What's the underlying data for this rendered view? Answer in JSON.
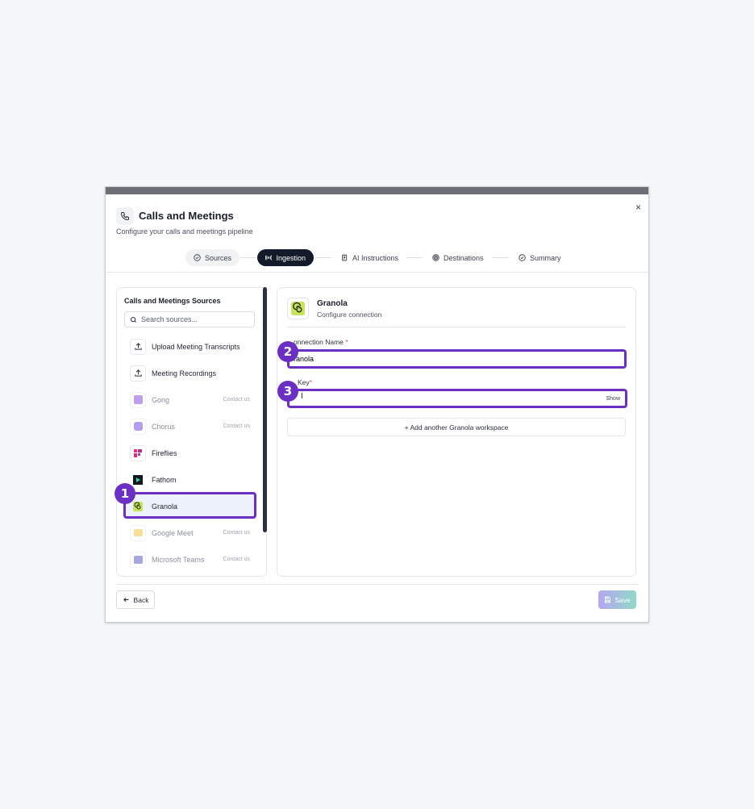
{
  "dialog": {
    "title": "Calls and Meetings",
    "subtitle": "Configure your calls and meetings pipeline",
    "close_label": "×"
  },
  "steps": [
    {
      "label": "Sources",
      "state": "done",
      "icon": "check-circle-icon"
    },
    {
      "label": "Ingestion",
      "state": "active",
      "icon": "broadcast-icon"
    },
    {
      "label": "AI Instructions",
      "state": "pending",
      "icon": "document-ai-icon"
    },
    {
      "label": "Destinations",
      "state": "pending",
      "icon": "target-icon"
    },
    {
      "label": "Summary",
      "state": "pending",
      "icon": "check-circle-icon"
    }
  ],
  "sources_panel": {
    "title": "Calls and Meetings Sources",
    "search_placeholder": "Search sources...",
    "items": [
      {
        "label": "Upload Meeting Transcripts",
        "icon": "upload-icon",
        "disabled": false
      },
      {
        "label": "Meeting Recordings",
        "icon": "upload-icon",
        "disabled": false
      },
      {
        "label": "Gong",
        "icon": "gong-logo-icon",
        "disabled": true,
        "note": "Contact us"
      },
      {
        "label": "Chorus",
        "icon": "chorus-logo-icon",
        "disabled": true,
        "note": "Contact us"
      },
      {
        "label": "Fireflies",
        "icon": "fireflies-logo-icon",
        "disabled": false
      },
      {
        "label": "Fathom",
        "icon": "fathom-logo-icon",
        "disabled": false
      },
      {
        "label": "Granola",
        "icon": "granola-logo-icon",
        "disabled": false,
        "selected": true
      },
      {
        "label": "Google Meet",
        "icon": "google-meet-logo-icon",
        "disabled": true,
        "note": "Contact us"
      },
      {
        "label": "Microsoft Teams",
        "icon": "teams-logo-icon",
        "disabled": true,
        "note": "Contact us"
      }
    ]
  },
  "config": {
    "name": "Granola",
    "subtitle": "Configure connection",
    "connection_name_label": "onnection Name",
    "connection_name_value": "ranola",
    "api_key_label": "Key",
    "api_key_value": "",
    "show_label": "Show",
    "required_mark": "*",
    "add_workspace_label": "+ Add another Granola workspace"
  },
  "footer": {
    "back_label": "Back",
    "save_label": "Save"
  },
  "annotations": [
    "1",
    "2",
    "3"
  ],
  "colors": {
    "highlight": "#6b2fc4",
    "active_step_bg": "#131a29",
    "selected_row_bg": "#edf1fb"
  }
}
